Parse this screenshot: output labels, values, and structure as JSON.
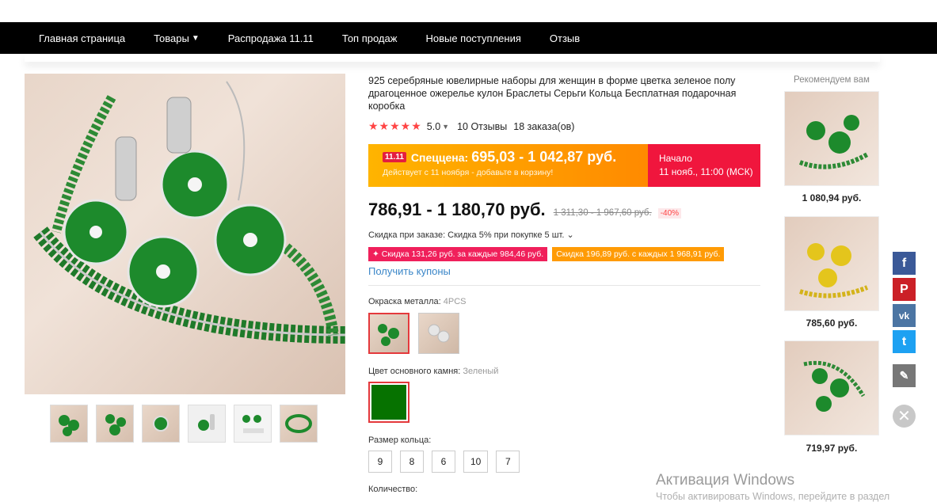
{
  "nav": {
    "items": [
      "Главная страница",
      "Товары",
      "Распродажа 11.11",
      "Топ продаж",
      "Новые поступления",
      "Отзыв"
    ]
  },
  "product": {
    "title": "925 серебряные ювелирные наборы для женщин в форме цветка зеленое полу драгоценное ожерелье кулон Браслеты Серьги Кольца Бесплатная подарочная коробка",
    "stars": "★★★★★",
    "rating": "5.0",
    "reviews": "10 Отзывы",
    "orders": "18 заказа(ов)"
  },
  "promo": {
    "badge": "11.11",
    "label": "Спеццена:",
    "price": "695,03 - 1 042,87 руб.",
    "note": "Действует с 11 ноября - добавьте в корзину!",
    "start_label": "Начало",
    "start_time": "11 нояб., 11:00 (МСК)"
  },
  "price": {
    "main": "786,91 - 1 180,70 руб.",
    "old": "1 311,30 - 1 967,60 руб.",
    "discount": "-40%"
  },
  "order_discount": "Скидка при заказе: Скидка 5% при покупке 5 шт. ⌄",
  "coupons": [
    "✦ Скидка 131,26 руб. за каждые 984,46 руб.",
    "Скидка 196,89 руб. с каждых 1 968,91 руб."
  ],
  "get_coupons": "Получить купоны",
  "metal": {
    "label": "Окраска металла: ",
    "value": "4PCS"
  },
  "stone": {
    "label": "Цвет основного камня: ",
    "value": "Зеленый"
  },
  "ring_size": {
    "label": "Размер кольца:",
    "options": [
      "9",
      "8",
      "6",
      "10",
      "7"
    ]
  },
  "quantity_label": "Количество:",
  "recommend": {
    "title": "Рекомендуем вам",
    "items": [
      {
        "price": "1 080,94 руб."
      },
      {
        "price": "785,60 руб."
      },
      {
        "price": "719,97 руб."
      }
    ]
  },
  "social": {
    "facebook": "f",
    "pinterest": "P",
    "vk": "vk",
    "twitter": "t",
    "edit": "✎",
    "close": "✕"
  },
  "watermark": {
    "line1": "Активация Windows",
    "line2": "Чтобы активировать Windows, перейдите в раздел"
  },
  "colors": {
    "accent": "#f0163d",
    "promo": "#ff9b05",
    "link": "#3a86c8",
    "green_stone": "#067200"
  }
}
